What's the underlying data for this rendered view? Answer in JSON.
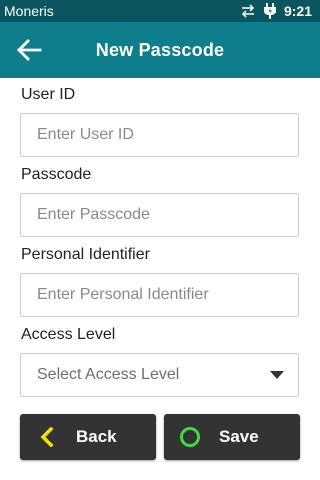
{
  "status_bar": {
    "carrier": "Moneris",
    "time": "9:21",
    "icons": [
      "data-transfer-icon",
      "charging-plug-icon"
    ]
  },
  "app_bar": {
    "title": "New Passcode",
    "back_icon": "arrow-left-icon"
  },
  "form": {
    "user_id": {
      "label": "User ID",
      "placeholder": "Enter User ID",
      "value": ""
    },
    "passcode": {
      "label": "Passcode",
      "placeholder": "Enter Passcode",
      "value": ""
    },
    "personal_identifier": {
      "label": "Personal Identifier",
      "placeholder": "Enter Personal Identifier",
      "value": ""
    },
    "access_level": {
      "label": "Access Level",
      "selected": "Select Access Level"
    }
  },
  "actions": {
    "back": {
      "label": "Back",
      "icon": "chevron-left-icon",
      "icon_color": "#f2e600"
    },
    "save": {
      "label": "Save",
      "icon": "circle-icon",
      "icon_color": "#3ddc3d"
    }
  },
  "colors": {
    "status_bar": "#0a5560",
    "app_bar": "#0e7e8c",
    "button_bg": "#333333"
  }
}
